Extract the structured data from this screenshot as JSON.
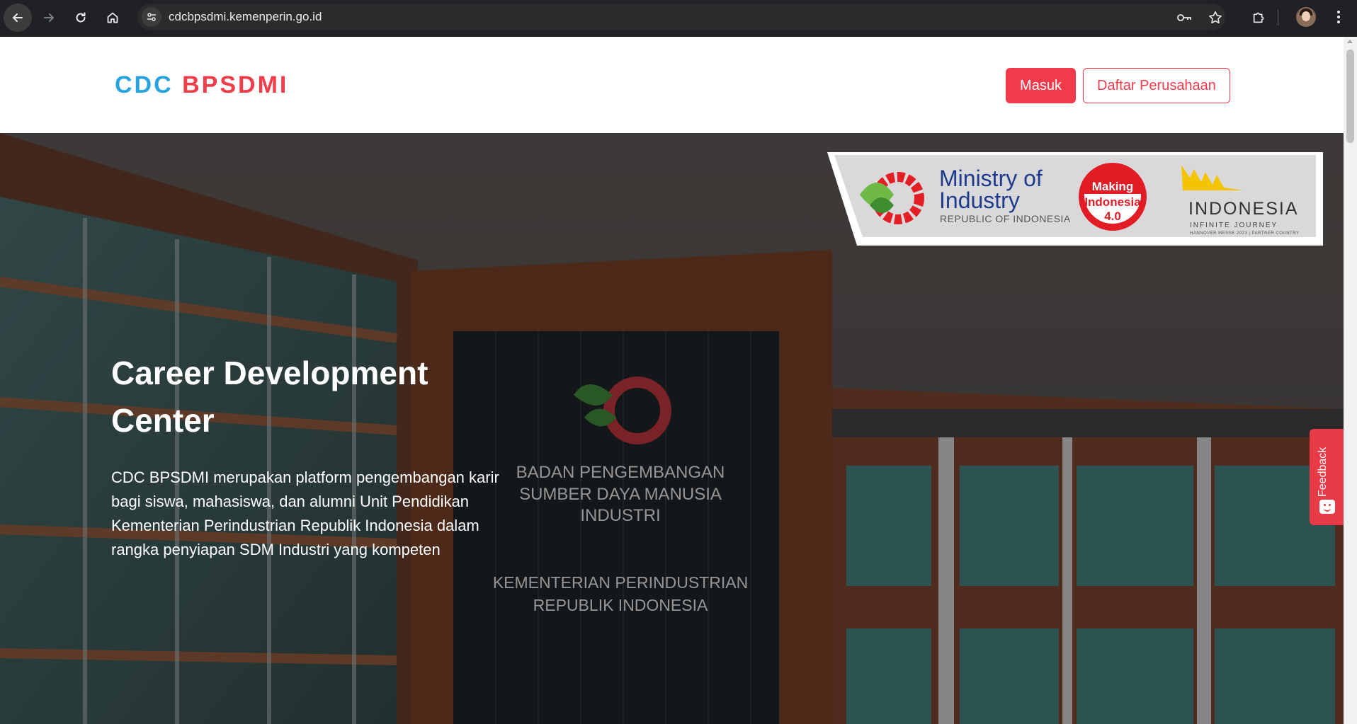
{
  "browser": {
    "url": "cdcbpsdmi.kemenperin.go.id"
  },
  "header": {
    "logo_left": "CDC",
    "logo_right": "BPSDMI",
    "login_label": "Masuk",
    "register_label": "Daftar Perusahaan"
  },
  "hero": {
    "title": "Career Development Center",
    "description": "CDC BPSDMI merupakan platform pengembangan karir bagi siswa, mahasiswa, dan alumni Unit Pendidikan Kementerian Perindustrian Republik Indonesia dalam rangka penyiapan SDM Industri yang kompeten",
    "building_sign_line1": "BADAN PENGEMBANGAN",
    "building_sign_line2": "SUMBER DAYA MANUSIA",
    "building_sign_line3": "INDUSTRI",
    "building_sign_line4": "KEMENTERIAN PERINDUSTRIAN",
    "building_sign_line5": "REPUBLIK INDONESIA"
  },
  "sponsor": {
    "ministry_line1": "Ministry of",
    "ministry_line2": "Industry",
    "ministry_sub": "REPUBLIC OF INDONESIA",
    "making_line1": "Making",
    "making_line2": "Indonesia",
    "making_line3": "4.0",
    "indonesia_word": "INDONESIA",
    "indonesia_sub": "INFINITE JOURNEY",
    "indonesia_sub2": "HANNOVER MESSE 2023 | PARTNER COUNTRY"
  },
  "feedback": {
    "label": "Feedback"
  },
  "colors": {
    "brand_blue": "#27a4e0",
    "brand_red": "#ef3e4a",
    "button_red": "#f23a4a"
  }
}
